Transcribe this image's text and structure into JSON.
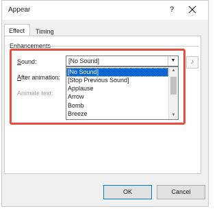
{
  "dialog": {
    "title": "Appear",
    "help_icon": "?",
    "close_icon": "close-icon"
  },
  "tabs": [
    {
      "label": "Effect",
      "selected": true
    },
    {
      "label": "Timing",
      "selected": false
    }
  ],
  "enhancements": {
    "group_label": "Enhancements",
    "sound_label_prefix": "S",
    "sound_label_rest": "ound:",
    "after_animation_label_prefix": "A",
    "after_animation_label_rest": "fter animation:",
    "animate_text_label": "Animate text:",
    "sound_combo": {
      "value": "[No Sound]",
      "options": [
        "[No Sound]",
        "[Stop Previous Sound]",
        "Applause",
        "Arrow",
        "Bomb",
        "Breeze"
      ],
      "selected_index": 0
    }
  },
  "buttons": {
    "ok": "OK",
    "cancel": "Cancel"
  },
  "colors": {
    "highlight": "#ea4b3c",
    "selection": "#0a64d2"
  }
}
